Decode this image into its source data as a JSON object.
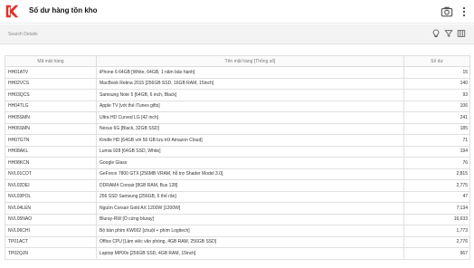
{
  "app": {
    "title": "Số dư hàng tồn kho",
    "brand_color": "#e0312b"
  },
  "search": {
    "placeholder": "Search Details"
  },
  "table": {
    "headers": [
      "Mã mặt hàng",
      "Tên mặt hàng [Thông số]",
      "Số dư"
    ],
    "rows": [
      [
        "HH01ATV",
        "iPhone 6 64GB [White, 64GB, 1 năm bảo hành]",
        "15"
      ],
      [
        "HH02VCS",
        "MacBook Retina 2015 [256GB SSD, 16GB RAM, 15inch]",
        "140"
      ],
      [
        "HH03QCS",
        "Samsung Note 5 [64GB, 6 inch, Black]",
        "93"
      ],
      [
        "HH04TLG",
        "Apple TV [với thẻ iTunes gifts]",
        "106"
      ],
      [
        "HH05SMN",
        "Ultra HD Curved LG [42 inch]",
        "241"
      ],
      [
        "HH06SMN",
        "Nexus 6G [Black, 32GB SSD]",
        "185"
      ],
      [
        "HH07GTN",
        "Kindle HD [64GB với 50 GB lưu trữ Amazon Cloud]",
        "71"
      ],
      [
        "HH08AKL",
        "Lumia 928 [64GB SSD, White]",
        "194"
      ],
      [
        "HH08KCN",
        "Google Glass",
        "76"
      ],
      [
        "NVL01COT",
        "GeForce 7800 GTX [256MB VRAM, hỗ trợ Shader Model 3.0]",
        "2,815"
      ],
      [
        "NVL02DEI",
        "DDRAM4 Corsair [8GB RAM, Bus 128]",
        "2,775"
      ],
      [
        "NVL03POL",
        "256 SSD Samsung [256GB, 6 thế răn]",
        "47"
      ],
      [
        "NVL04LEN",
        "Nguồn Corsair Gold AX 1200W [1200W]",
        "7,134"
      ],
      [
        "NVL05NAO",
        "Bluray-RW [Ổ cứng bluray]",
        "16,633"
      ],
      [
        "NVL06CHI",
        "Bộ bàn phím KW002 [chuột + phím Logitech]",
        "1,773"
      ],
      [
        "TP01ACT",
        "Office CPU [Làm việc văn phòng, 4GB RAM, 256GB SSD]",
        "2,776"
      ],
      [
        "TP02QJN",
        "Laptop MP00x [256GB SSD, 4GB RAM, 15inch]",
        "967"
      ]
    ]
  },
  "icons": {
    "logo": "brand-logo-icon",
    "camera": "camera-icon",
    "more": "more-vertical-icon",
    "bulb": "lightbulb-icon",
    "filter": "filter-icon",
    "columns": "columns-icon"
  }
}
